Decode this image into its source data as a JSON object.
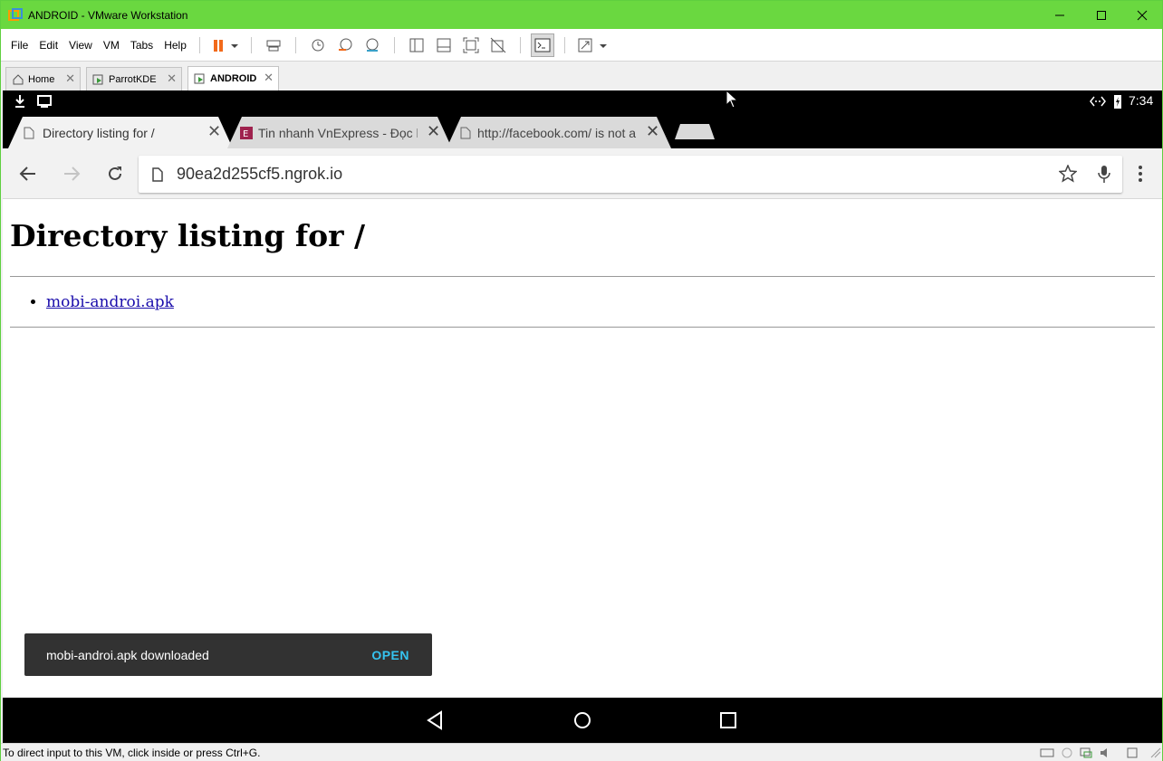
{
  "window": {
    "title": "ANDROID - VMware Workstation"
  },
  "menu": [
    "File",
    "Edit",
    "View",
    "VM",
    "Tabs",
    "Help"
  ],
  "vm_tabs": [
    {
      "label": "Home"
    },
    {
      "label": "ParrotKDE"
    },
    {
      "label": "ANDROID"
    }
  ],
  "android": {
    "status_time": "7:34",
    "chrome_tabs": [
      {
        "label": "Directory listing for /"
      },
      {
        "label": "Tin nhanh VnExpress - Đọc báo"
      },
      {
        "label": "http://facebook.com/ is not a"
      }
    ],
    "url": "90ea2d255cf5.ngrok.io",
    "page": {
      "heading": "Directory listing for /",
      "files": [
        "mobi-androi.apk"
      ]
    },
    "snackbar": {
      "message": "mobi-androi.apk downloaded",
      "action": "OPEN"
    }
  },
  "status_bar_text": "To direct input to this VM, click inside or press Ctrl+G.",
  "colors": {
    "titlebar": "#6ad840",
    "accent": "#35c3f0",
    "link": "#1a0dab"
  }
}
